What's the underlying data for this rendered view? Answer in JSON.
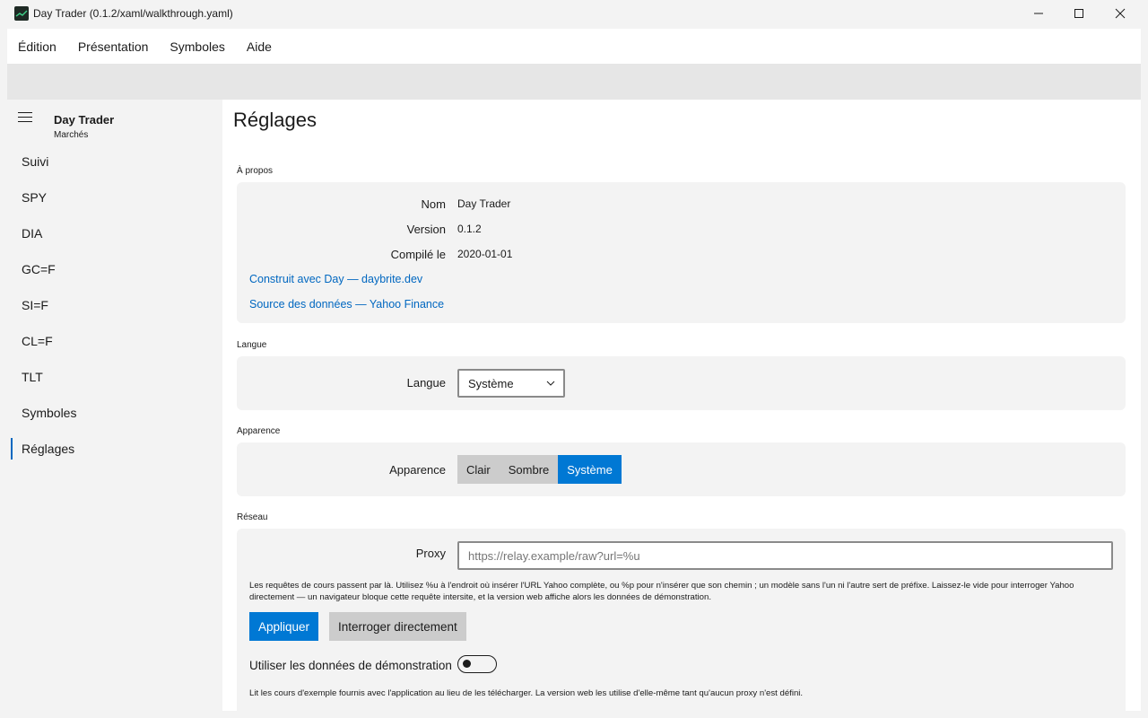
{
  "window": {
    "title": "Day Trader (0.1.2/xaml/walkthrough.yaml)",
    "app_icon": "chart-line-icon"
  },
  "menu": [
    "Édition",
    "Présentation",
    "Symboles",
    "Aide"
  ],
  "sidebar": {
    "title": "Day Trader",
    "subtitle": "Marchés",
    "items": [
      {
        "label": "Suivi"
      },
      {
        "label": "SPY"
      },
      {
        "label": "DIA"
      },
      {
        "label": "GC=F"
      },
      {
        "label": "SI=F"
      },
      {
        "label": "CL=F"
      },
      {
        "label": "TLT"
      },
      {
        "label": "Symboles"
      },
      {
        "label": "Réglages",
        "active": true
      }
    ]
  },
  "main": {
    "title": "Réglages",
    "about": {
      "section": "À propos",
      "name_label": "Nom",
      "name_value": "Day Trader",
      "version_label": "Version",
      "version_value": "0.1.2",
      "built_label": "Compilé le",
      "built_value": "2020-01-01",
      "link1": "Construit avec Day — daybrite.dev",
      "link2": "Source des données — Yahoo Finance"
    },
    "language": {
      "section": "Langue",
      "label": "Langue",
      "selected": "Système"
    },
    "appearance": {
      "section": "Apparence",
      "label": "Apparence",
      "options": [
        "Clair",
        "Sombre",
        "Système"
      ],
      "selected": "Système"
    },
    "network": {
      "section": "Réseau",
      "proxy_label": "Proxy",
      "proxy_value": "",
      "proxy_placeholder": "https://relay.example/raw?url=%u",
      "help": "Les requêtes de cours passent par là. Utilisez %u à l'endroit où insérer l'URL Yahoo complète, ou %p pour n'insérer que son chemin ; un modèle sans l'un ni l'autre sert de préfixe. Laissez-le vide pour interroger Yahoo directement — un navigateur bloque cette requête intersite, et la version web affiche alors les données de démonstration.",
      "apply_label": "Appliquer",
      "direct_label": "Interroger directement",
      "demo_label": "Utiliser les données de démonstration",
      "demo_enabled": false,
      "demo_help": "Lit les cours d'exemple fournis avec l'application au lieu de les télécharger. La version web les utilise d'elle-même tant qu'aucun proxy n'est défini."
    }
  },
  "colors": {
    "accent": "#0078d4",
    "link": "#0067c0",
    "card": "#f3f3f3"
  }
}
